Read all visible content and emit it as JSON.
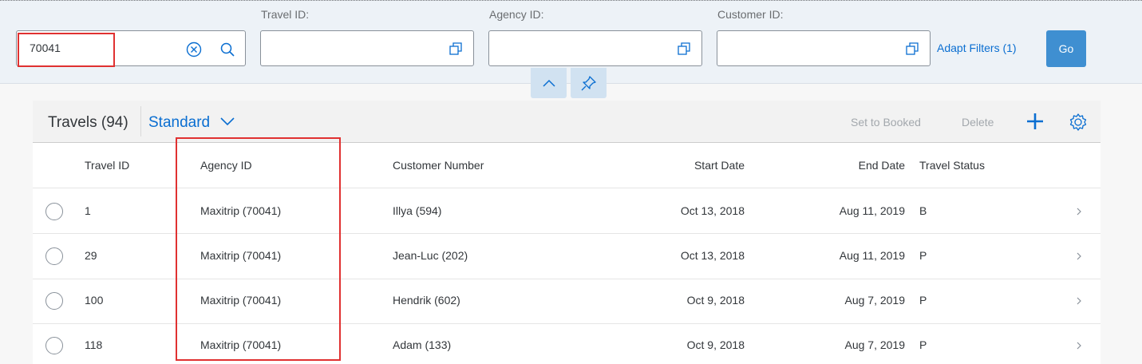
{
  "filters": {
    "search": {
      "value": "70041"
    },
    "travel_id": {
      "label": "Travel ID:",
      "value": ""
    },
    "agency_id": {
      "label": "Agency ID:",
      "value": ""
    },
    "customer_id": {
      "label": "Customer ID:",
      "value": ""
    },
    "adapt_label": "Adapt Filters (1)",
    "go_label": "Go"
  },
  "table": {
    "title": "Travels (94)",
    "variant": "Standard",
    "actions": {
      "set_booked": "Set to Booked",
      "delete": "Delete"
    },
    "columns": [
      "Travel ID",
      "Agency ID",
      "Customer Number",
      "Start Date",
      "End Date",
      "Travel Status"
    ],
    "rows": [
      {
        "travel_id": "1",
        "agency": "Maxitrip (70041)",
        "customer": "Illya (594)",
        "start": "Oct 13, 2018",
        "end": "Aug 11, 2019",
        "status": "B"
      },
      {
        "travel_id": "29",
        "agency": "Maxitrip (70041)",
        "customer": "Jean-Luc (202)",
        "start": "Oct 13, 2018",
        "end": "Aug 11, 2019",
        "status": "P"
      },
      {
        "travel_id": "100",
        "agency": "Maxitrip (70041)",
        "customer": "Hendrik (602)",
        "start": "Oct 9, 2018",
        "end": "Aug 7, 2019",
        "status": "P"
      },
      {
        "travel_id": "118",
        "agency": "Maxitrip (70041)",
        "customer": "Adam (133)",
        "start": "Oct 9, 2018",
        "end": "Aug 7, 2019",
        "status": "P"
      }
    ]
  },
  "colors": {
    "accent": "#0a6ed1",
    "highlight": "#e03131",
    "go": "#3f8fd1"
  }
}
